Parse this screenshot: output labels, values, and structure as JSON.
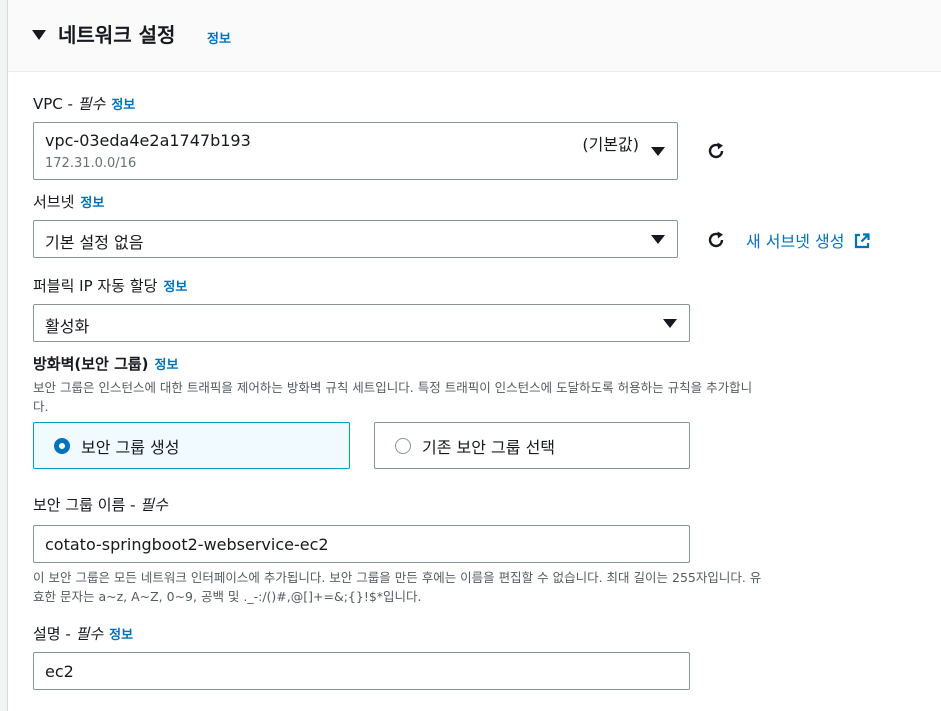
{
  "section": {
    "title": "네트워크 설정",
    "info": "정보"
  },
  "vpc": {
    "label": "VPC - ",
    "required": "필수",
    "info": "정보",
    "value": "vpc-03eda4e2a1747b193",
    "default_tag": "(기본값)",
    "sub": "172.31.0.0/16"
  },
  "subnet": {
    "label": "서브넷",
    "info": "정보",
    "value": "기본 설정 없음",
    "create_link": "새 서브넷 생성"
  },
  "public_ip": {
    "label": "퍼블릭 IP 자동 할당",
    "info": "정보",
    "value": "활성화"
  },
  "firewall": {
    "label": "방화벽(보안 그룹)",
    "info": "정보",
    "desc_line1": "보안 그룹은 인스턴스에 대한 트래픽을 제어하는 방화벽 규칙 세트입니다. 특정 트래픽이 인스턴스에 도달하도록 허용하는 규칙을 추가합니",
    "desc_line2": "다.",
    "option_create": "보안 그룹 생성",
    "option_existing": "기존 보안 그룹 선택",
    "selected": "create"
  },
  "sg_name": {
    "label": "보안 그룹 이름 - ",
    "required": "필수",
    "value": "cotato-springboot2-webservice-ec2",
    "help_line1": "이 보안 그룹은 모든 네트워크 인터페이스에 추가됩니다. 보안 그룹을 만든 후에는 이름을 편집할 수 없습니다. 최대 길이는 255자입니다. 유",
    "help_line2": "효한 문자는 a~z, A~Z, 0~9, 공백 및 ._-:/()#,@[]+=&;{}!$*입니다."
  },
  "description": {
    "label": "설명 - ",
    "required": "필수",
    "info": "정보",
    "value": "ec2"
  },
  "colors": {
    "link": "#0073bb",
    "selected_bg": "#f1faff",
    "selected_border": "#00a1c9"
  }
}
